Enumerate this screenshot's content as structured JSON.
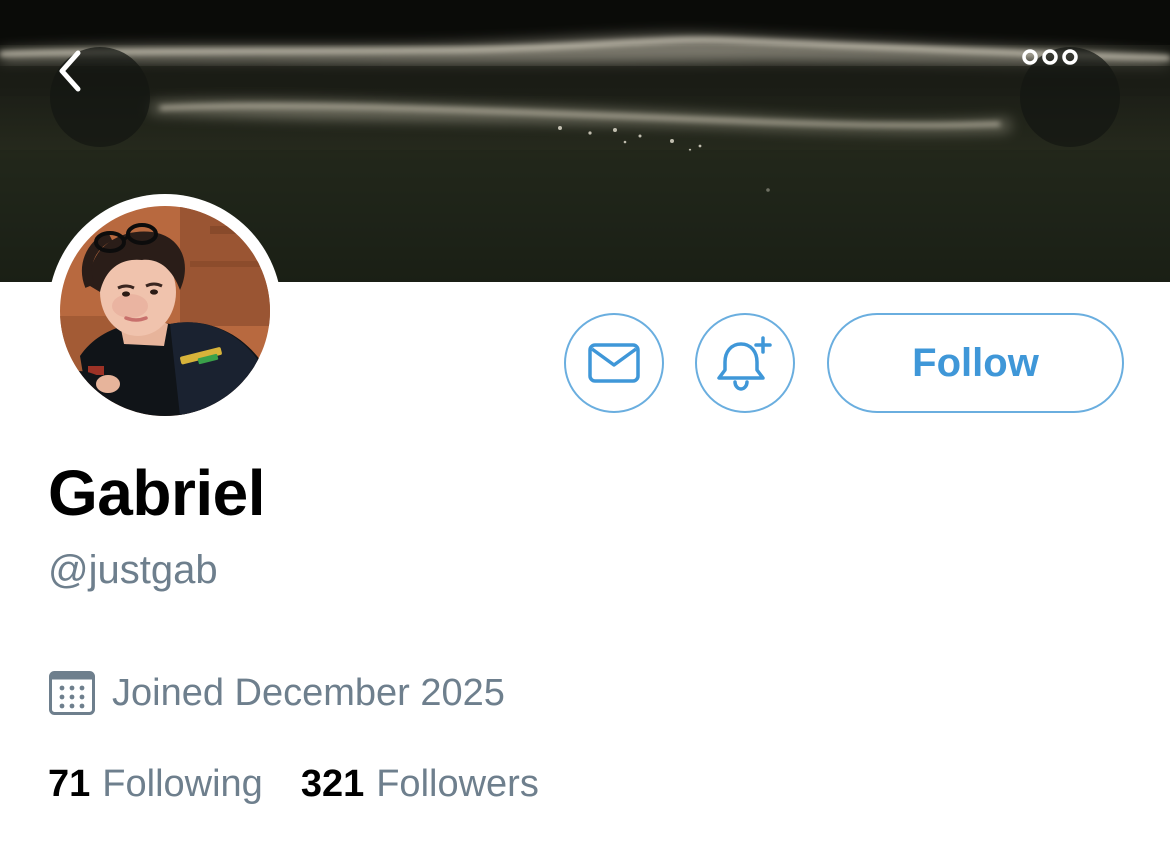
{
  "profile": {
    "display_name": "Gabriel",
    "handle": "@justgab",
    "joined": "Joined December 2025",
    "avatar": "profile-photo",
    "banner": "night-ocean-waves"
  },
  "stats": {
    "following_count": "71",
    "following_label": "Following",
    "followers_count": "321",
    "followers_label": "Followers"
  },
  "actions": {
    "follow_label": "Follow"
  },
  "icons": {
    "back": "chevron-left-icon",
    "more": "more-horizontal-icon",
    "message": "envelope-icon",
    "notify": "bell-plus-icon",
    "calendar": "calendar-icon"
  },
  "colors": {
    "accent": "#3f97d8",
    "accent_border": "#6aaedf",
    "secondary_text": "#6e7f8d",
    "primary_text": "#000000"
  }
}
